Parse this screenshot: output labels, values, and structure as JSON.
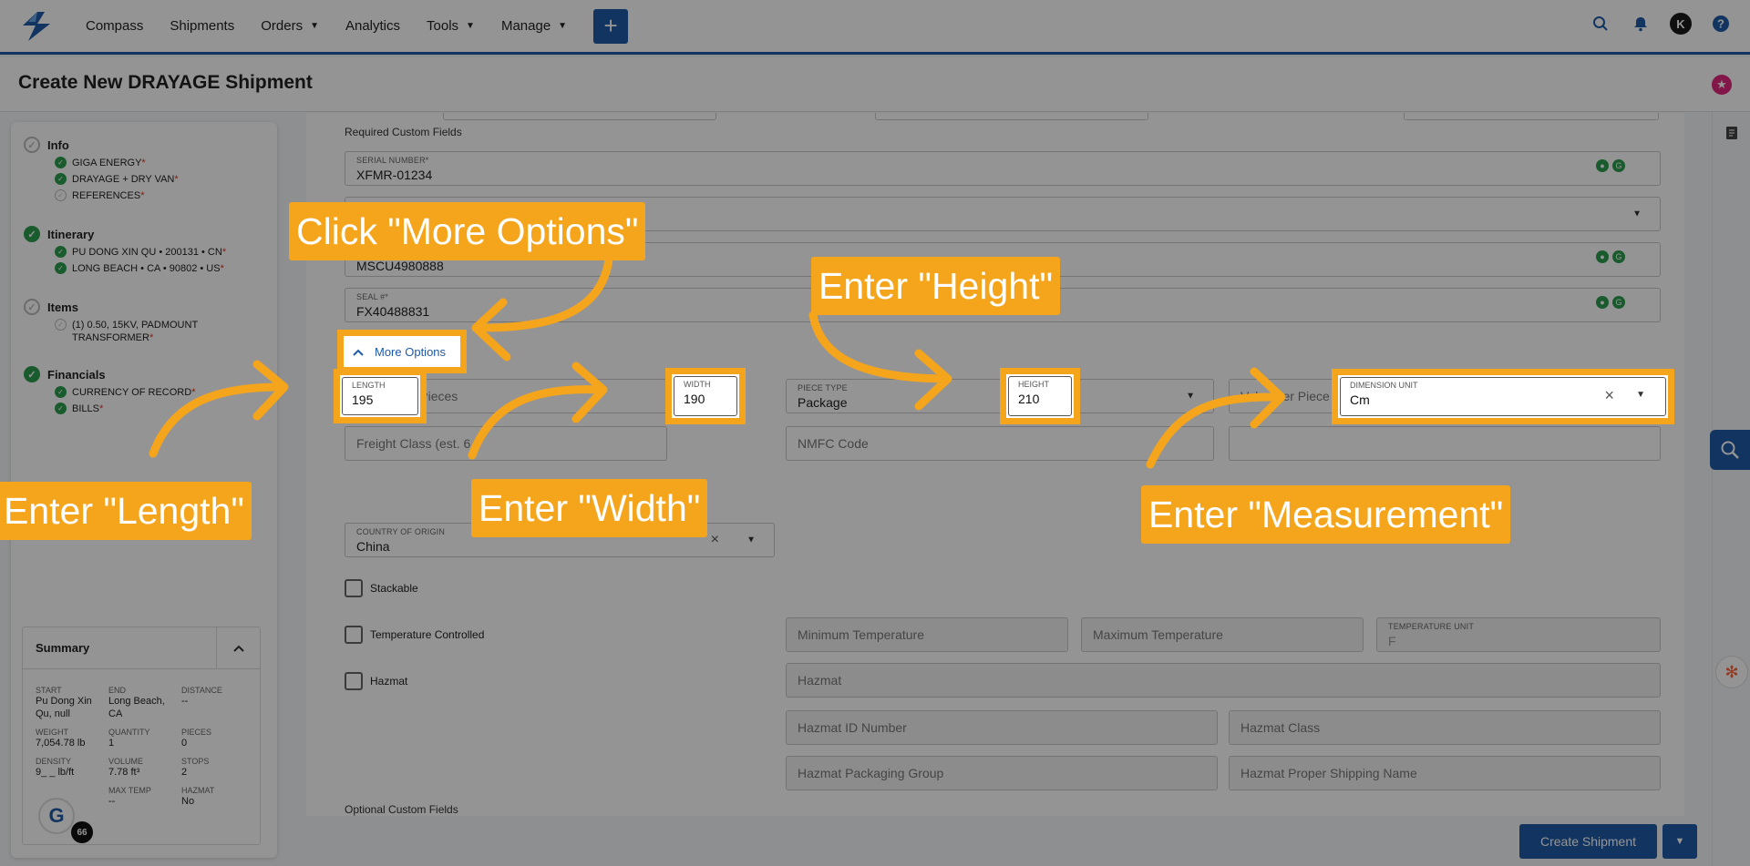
{
  "nav": {
    "items": [
      "Compass",
      "Shipments",
      "Orders",
      "Analytics",
      "Tools",
      "Manage"
    ],
    "with_caret": [
      false,
      false,
      true,
      false,
      true,
      true
    ],
    "add_label": "+",
    "avatar_initial": "K"
  },
  "header": {
    "title": "Create New DRAYAGE Shipment"
  },
  "progress": {
    "steps": [
      {
        "title": "Info",
        "state": "todo",
        "items": [
          {
            "label": "GIGA ENERGY",
            "state": "done"
          },
          {
            "label": "DRAYAGE + DRY VAN",
            "state": "done"
          },
          {
            "label": "REFERENCES",
            "state": "todo"
          }
        ]
      },
      {
        "title": "Itinerary",
        "state": "done",
        "items": [
          {
            "label": "PU DONG XIN QU • 200131 • CN",
            "state": "done"
          },
          {
            "label": "LONG BEACH • CA • 90802 • US",
            "state": "done"
          }
        ]
      },
      {
        "title": "Items",
        "state": "todo",
        "items": [
          {
            "label": "(1) 0.50, 15KV, PADMOUNT TRANSFORMER",
            "state": "todo"
          }
        ]
      },
      {
        "title": "Financials",
        "state": "done",
        "items": [
          {
            "label": "CURRENCY OF RECORD",
            "state": "done"
          },
          {
            "label": "BILLS",
            "state": "done"
          }
        ]
      }
    ],
    "required_mark": "*"
  },
  "summary": {
    "title": "Summary",
    "cells": [
      {
        "label": "Start",
        "value": "Pu Dong Xin Qu, null"
      },
      {
        "label": "End",
        "value": "Long Beach, CA"
      },
      {
        "label": "Distance",
        "value": "--"
      },
      {
        "label": "Weight",
        "value": "7,054.78 lb"
      },
      {
        "label": "Quantity",
        "value": "1"
      },
      {
        "label": "Pieces",
        "value": "0"
      },
      {
        "label": "Density",
        "value": "9_ _ lb/ft"
      },
      {
        "label": "Volume",
        "value": "7.78 ft³"
      },
      {
        "label": "Stops",
        "value": "2"
      },
      {
        "label": "",
        "value": ""
      },
      {
        "label": "Max Temp",
        "value": "--"
      },
      {
        "label": "Hazmat",
        "value": "No"
      }
    ],
    "badge_letter": "G",
    "badge_count": "66"
  },
  "form": {
    "required_custom_fields": "Required Custom Fields",
    "serial_number": {
      "label": "SERIAL NUMBER*",
      "value": "XFMR-01234"
    },
    "container_number": {
      "value": "MSCU4980888"
    },
    "seal_number": {
      "label": "SEAL #*",
      "value": "FX40488831"
    },
    "more_options": "More Options",
    "length": {
      "label": "LENGTH",
      "value": "195"
    },
    "width": {
      "label": "WIDTH",
      "value": "190"
    },
    "height": {
      "label": "HEIGHT",
      "value": "210"
    },
    "dimension_unit": {
      "label": "DIMENSION UNIT",
      "value": "Cm"
    },
    "number_of_pieces": "Number of Pieces",
    "piece_type": {
      "label": "PIECE TYPE",
      "value": "Package"
    },
    "value_per_piece": "Value per Piece (USD)",
    "freight_class": "Freight Class (est. 6",
    "nmfc_code": "NMFC Code",
    "country_of_origin": {
      "label": "COUNTRY OF ORIGIN",
      "value": "China"
    },
    "stackable": "Stackable",
    "temperature_controlled": "Temperature Controlled",
    "min_temp": "Minimum Temperature",
    "max_temp": "Maximum Temperature",
    "temp_unit": {
      "label": "TEMPERATURE UNIT",
      "value": "F"
    },
    "hazmat": "Hazmat",
    "hazmat_field": "Hazmat",
    "hazmat_id": "Hazmat ID Number",
    "hazmat_class": "Hazmat Class",
    "hazmat_packaging": "Hazmat Packaging Group",
    "hazmat_shipping_name": "Hazmat Proper Shipping Name",
    "optional_custom_fields": "Optional Custom Fields"
  },
  "footer": {
    "create_label": "Create Shipment"
  },
  "callouts": {
    "more_options": "Click \"More Options\"",
    "height": "Enter \"Height\"",
    "length": "Enter \"Length\"",
    "width": "Enter \"Width\"",
    "measurement": "Enter \"Measurement\""
  },
  "colors": {
    "accent": "#f5a51c",
    "brand": "#1f5aa6",
    "success": "#2e9e50"
  },
  "icons": {
    "search": "search-icon",
    "bell": "bell-icon",
    "help": "help-icon",
    "star": "star-icon"
  }
}
